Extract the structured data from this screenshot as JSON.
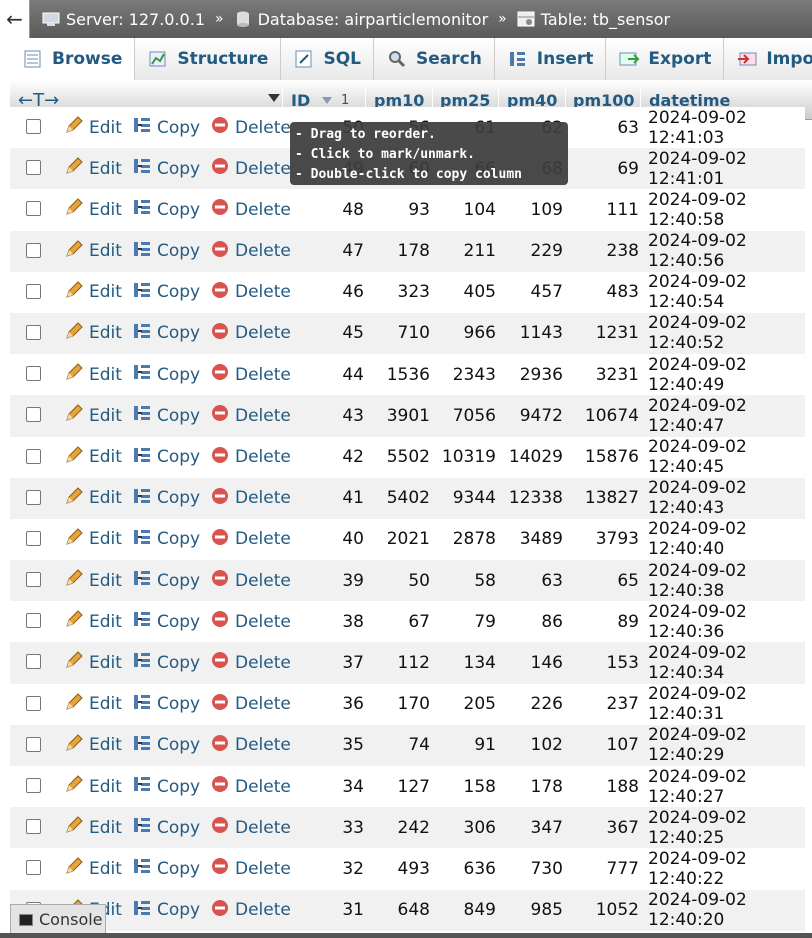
{
  "breadcrumb": {
    "back_label": "←",
    "server": "Server: 127.0.0.1",
    "database": "Database: airparticlemonitor",
    "table": "Table: tb_sensor",
    "separator": "»"
  },
  "tabs": [
    {
      "label": "Browse",
      "icon": "browse-icon"
    },
    {
      "label": "Structure",
      "icon": "structure-icon"
    },
    {
      "label": "SQL",
      "icon": "sql-icon"
    },
    {
      "label": "Search",
      "icon": "search-icon"
    },
    {
      "label": "Insert",
      "icon": "insert-icon"
    },
    {
      "label": "Export",
      "icon": "export-icon"
    },
    {
      "label": "Import",
      "icon": "import-icon"
    }
  ],
  "table_header": {
    "arrows": "←T→",
    "id": "ID",
    "sort_order": "1",
    "pm10": "pm10",
    "pm25": "pm25",
    "pm40": "pm40",
    "pm100": "pm100",
    "datetime": "datetime"
  },
  "actions": {
    "edit": "Edit",
    "copy": "Copy",
    "delete": "Delete"
  },
  "rows": [
    {
      "id": "50",
      "pm10": "56",
      "pm25": "61",
      "pm40": "62",
      "pm100": "63",
      "datetime": "2024-09-02 12:41:03"
    },
    {
      "id": "49",
      "pm10": "60",
      "pm25": "66",
      "pm40": "68",
      "pm100": "69",
      "datetime": "2024-09-02 12:41:01"
    },
    {
      "id": "48",
      "pm10": "93",
      "pm25": "104",
      "pm40": "109",
      "pm100": "111",
      "datetime": "2024-09-02 12:40:58"
    },
    {
      "id": "47",
      "pm10": "178",
      "pm25": "211",
      "pm40": "229",
      "pm100": "238",
      "datetime": "2024-09-02 12:40:56"
    },
    {
      "id": "46",
      "pm10": "323",
      "pm25": "405",
      "pm40": "457",
      "pm100": "483",
      "datetime": "2024-09-02 12:40:54"
    },
    {
      "id": "45",
      "pm10": "710",
      "pm25": "966",
      "pm40": "1143",
      "pm100": "1231",
      "datetime": "2024-09-02 12:40:52"
    },
    {
      "id": "44",
      "pm10": "1536",
      "pm25": "2343",
      "pm40": "2936",
      "pm100": "3231",
      "datetime": "2024-09-02 12:40:49"
    },
    {
      "id": "43",
      "pm10": "3901",
      "pm25": "7056",
      "pm40": "9472",
      "pm100": "10674",
      "datetime": "2024-09-02 12:40:47"
    },
    {
      "id": "42",
      "pm10": "5502",
      "pm25": "10319",
      "pm40": "14029",
      "pm100": "15876",
      "datetime": "2024-09-02 12:40:45"
    },
    {
      "id": "41",
      "pm10": "5402",
      "pm25": "9344",
      "pm40": "12338",
      "pm100": "13827",
      "datetime": "2024-09-02 12:40:43"
    },
    {
      "id": "40",
      "pm10": "2021",
      "pm25": "2878",
      "pm40": "3489",
      "pm100": "3793",
      "datetime": "2024-09-02 12:40:40"
    },
    {
      "id": "39",
      "pm10": "50",
      "pm25": "58",
      "pm40": "63",
      "pm100": "65",
      "datetime": "2024-09-02 12:40:38"
    },
    {
      "id": "38",
      "pm10": "67",
      "pm25": "79",
      "pm40": "86",
      "pm100": "89",
      "datetime": "2024-09-02 12:40:36"
    },
    {
      "id": "37",
      "pm10": "112",
      "pm25": "134",
      "pm40": "146",
      "pm100": "153",
      "datetime": "2024-09-02 12:40:34"
    },
    {
      "id": "36",
      "pm10": "170",
      "pm25": "205",
      "pm40": "226",
      "pm100": "237",
      "datetime": "2024-09-02 12:40:31"
    },
    {
      "id": "35",
      "pm10": "74",
      "pm25": "91",
      "pm40": "102",
      "pm100": "107",
      "datetime": "2024-09-02 12:40:29"
    },
    {
      "id": "34",
      "pm10": "127",
      "pm25": "158",
      "pm40": "178",
      "pm100": "188",
      "datetime": "2024-09-02 12:40:27"
    },
    {
      "id": "33",
      "pm10": "242",
      "pm25": "306",
      "pm40": "347",
      "pm100": "367",
      "datetime": "2024-09-02 12:40:25"
    },
    {
      "id": "32",
      "pm10": "493",
      "pm25": "636",
      "pm40": "730",
      "pm100": "777",
      "datetime": "2024-09-02 12:40:22"
    },
    {
      "id": "31",
      "pm10": "648",
      "pm25": "849",
      "pm40": "985",
      "pm100": "1052",
      "datetime": "2024-09-02 12:40:20"
    }
  ],
  "tooltip": {
    "line1": "- Drag to reorder.",
    "line2": "- Click to mark/unmark.",
    "line3": "- Double-click to copy column name."
  },
  "console": {
    "label": "Console"
  },
  "colors": {
    "link": "#235a81",
    "delete_red": "#d9534f",
    "edit_pencil": "#e8a33a",
    "row_alt": "#f1f1f1"
  }
}
